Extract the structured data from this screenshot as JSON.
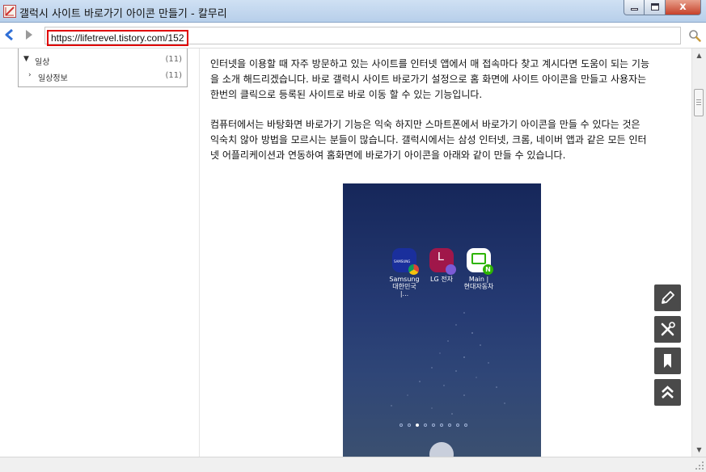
{
  "window": {
    "title": "갤럭시 사이트 바로가기 아이콘 만들기 - 칼무리",
    "minimize_icon": "minimize-icon",
    "maximize_icon": "maximize-icon",
    "close_label": "x"
  },
  "navigation": {
    "back_icon": "back-arrow-icon",
    "forward_icon": "forward-arrow-icon",
    "url": "https://lifetrevel.tistory.com/152",
    "search_icon": "magnifier-icon",
    "highlight_color": "#e00000"
  },
  "sidebar": {
    "categories": [
      {
        "arrow": "▼",
        "label": "일상",
        "count": "(11)"
      },
      {
        "arrow": "›",
        "label": "일상정보",
        "count": "(11)"
      }
    ]
  },
  "article": {
    "paragraphs": [
      "인터넷을 이용할 때 자주 방문하고 있는 사이트를 인터넷 앱에서 매 접속마다 찾고 계시다면 도움이 되는 기능\n을 소개 해드리겠습니다. 바로 갤럭시 사이트 바로가기 설정으로 홈 화면에 사이트 아이콘을 만들고 사용자는\n한번의 클릭으로 등록된 사이트로 바로 이동 할 수 있는 기능입니다.",
      "컴퓨터에서는 바탕화면 바로가기 기능은 익숙 하지만 스마트폰에서 바로가기 아이콘을 만들 수 있다는 것은\n익숙치 않아 방법을 모르시는 분들이 많습니다. 갤럭시에서는 삼성 인터넷, 크롬, 네이버 앱과 같은 모든 인터\n넷 어플리케이션과 연동하여 홈화면에 바로가기 아이콘을 아래와 같이 만들 수 있습니다."
    ],
    "phone_screenshot": {
      "apps": [
        {
          "label": "Samsung\n대한민국 |...",
          "badge_icon": "chrome-icon",
          "tiny_text": "SAMSUNG"
        },
        {
          "label": "LG 전자",
          "letter": "L",
          "badge_icon": "samsung-internet-icon"
        },
        {
          "label": "Main |\n현대자동차",
          "badge_icon": "naver-icon",
          "badge_letter": "N"
        }
      ],
      "page_dot_count": 9,
      "active_dot": 3,
      "apps_drawer_icon": "apps-grid-icon"
    }
  },
  "floating_tools": [
    {
      "icon": "pen-icon"
    },
    {
      "icon": "tools-icon"
    },
    {
      "icon": "bookmark-icon"
    },
    {
      "icon": "scroll-top-icon"
    }
  ],
  "scrollbar": {
    "up_icon": "▲",
    "down_icon": "▼"
  }
}
